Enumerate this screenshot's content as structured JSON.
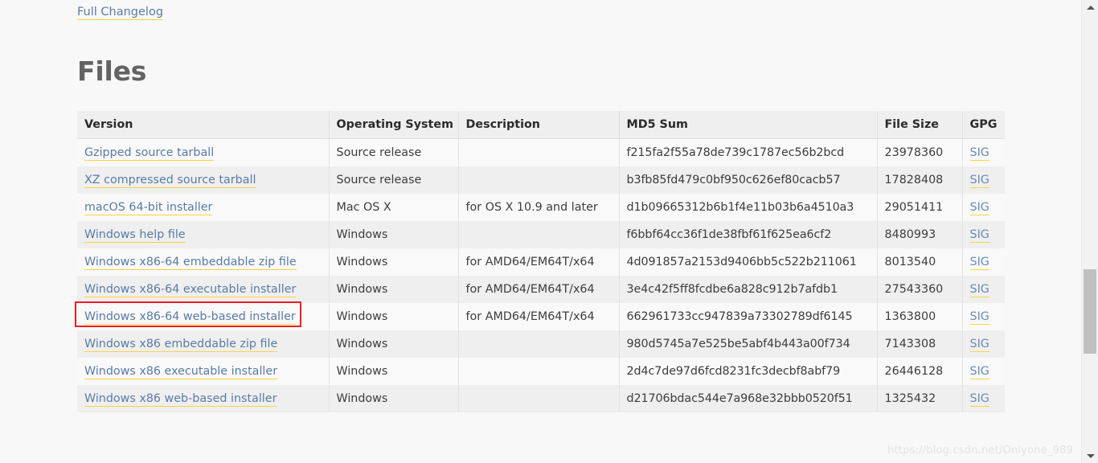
{
  "page": {
    "changelog_link": "Full Changelog",
    "heading": "Files",
    "watermark": "https://blog.csdn.net/Onlyone_989",
    "accent_underline": "#ffd43b",
    "link_color": "#5a7ba6",
    "heading_color": "#636363",
    "annotation_color": "#ee1c25",
    "annotated_row_label": "Windows x86-64 web-based installer"
  },
  "table": {
    "columns": [
      "Version",
      "Operating System",
      "Description",
      "MD5 Sum",
      "File Size",
      "GPG"
    ],
    "rows": [
      {
        "version": "Gzipped source tarball",
        "os": "Source release",
        "description": "",
        "md5": "f215fa2f55a78de739c1787ec56b2bcd",
        "size": "23978360",
        "gpg": "SIG"
      },
      {
        "version": "XZ compressed source tarball",
        "os": "Source release",
        "description": "",
        "md5": "b3fb85fd479c0bf950c626ef80cacb57",
        "size": "17828408",
        "gpg": "SIG"
      },
      {
        "version": "macOS 64-bit installer",
        "os": "Mac OS X",
        "description": "for OS X 10.9 and later",
        "md5": "d1b09665312b6b1f4e11b03b6a4510a3",
        "size": "29051411",
        "gpg": "SIG"
      },
      {
        "version": "Windows help file",
        "os": "Windows",
        "description": "",
        "md5": "f6bbf64cc36f1de38fbf61f625ea6cf2",
        "size": "8480993",
        "gpg": "SIG"
      },
      {
        "version": "Windows x86-64 embeddable zip file",
        "os": "Windows",
        "description": "for AMD64/EM64T/x64",
        "md5": "4d091857a2153d9406bb5c522b211061",
        "size": "8013540",
        "gpg": "SIG"
      },
      {
        "version": "Windows x86-64 executable installer",
        "os": "Windows",
        "description": "for AMD64/EM64T/x64",
        "md5": "3e4c42f5ff8fcdbe6a828c912b7afdb1",
        "size": "27543360",
        "gpg": "SIG"
      },
      {
        "version": "Windows x86-64 web-based installer",
        "os": "Windows",
        "description": "for AMD64/EM64T/x64",
        "md5": "662961733cc947839a73302789df6145",
        "size": "1363800",
        "gpg": "SIG"
      },
      {
        "version": "Windows x86 embeddable zip file",
        "os": "Windows",
        "description": "",
        "md5": "980d5745a7e525be5abf4b443a00f734",
        "size": "7143308",
        "gpg": "SIG"
      },
      {
        "version": "Windows x86 executable installer",
        "os": "Windows",
        "description": "",
        "md5": "2d4c7de97d6fcd8231fc3decbf8abf79",
        "size": "26446128",
        "gpg": "SIG"
      },
      {
        "version": "Windows x86 web-based installer",
        "os": "Windows",
        "description": "",
        "md5": "d21706bdac544e7a968e32bbb0520f51",
        "size": "1325432",
        "gpg": "SIG"
      }
    ]
  },
  "scrollbar": {
    "up_arrow": "scroll-up-arrow",
    "down_arrow": "scroll-down-arrow"
  }
}
